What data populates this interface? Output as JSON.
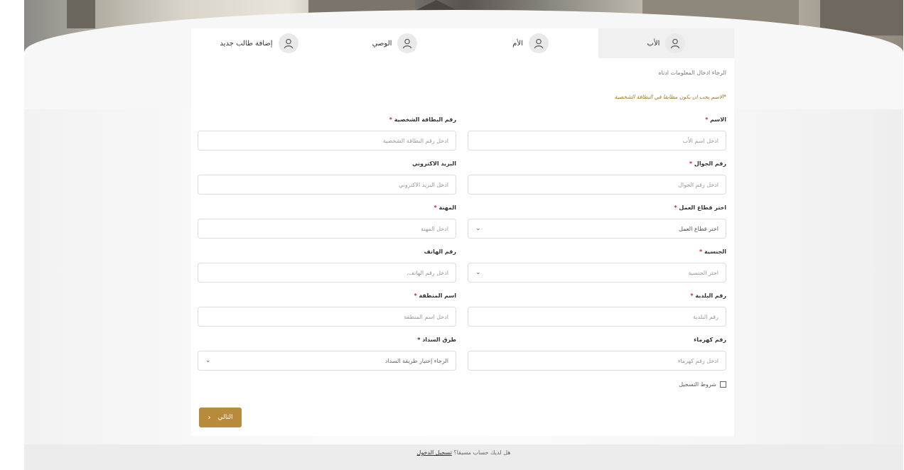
{
  "tabs": [
    {
      "label": "الأب",
      "icon": "user-icon",
      "active": true
    },
    {
      "label": "الأم",
      "icon": "user-icon",
      "active": false
    },
    {
      "label": "الوصي",
      "icon": "user-icon",
      "active": false
    },
    {
      "label": "إضافة طالب جديد",
      "icon": "user-icon",
      "active": false
    }
  ],
  "notes": {
    "intro": "الرجاء ادخال المعلومات ادناه",
    "name_warning": "*الاسم يجب ان يكون مطابقا في البطاقة الشخصية"
  },
  "fields": {
    "name": {
      "label": "الاسم",
      "required": "*",
      "placeholder": "ادخل اسم الأب"
    },
    "id_number": {
      "label": "رقم البطاقة الشخصية",
      "required": "*",
      "placeholder": "ادخل رقم البطاقة الشخصية"
    },
    "mobile": {
      "label": "رقم الجوال",
      "required": "*",
      "placeholder": "ادخل رقم الجوال"
    },
    "email": {
      "label": "البريد الاكتروني",
      "required": "",
      "placeholder": "ادخل البريد الاكتروني"
    },
    "work_sector": {
      "label": "اختر قطاع العمل",
      "required": "*",
      "placeholder": "اختر قطاع العمل"
    },
    "profession": {
      "label": "المهنة",
      "required": "*",
      "placeholder": "ادخل المهنة"
    },
    "nationality": {
      "label": "الجنسية",
      "required": "*",
      "placeholder": "اختر الجنسية"
    },
    "phone": {
      "label": "رقم الهاتف",
      "required": "",
      "placeholder": "ادخل رقم الهاتف."
    },
    "municipality": {
      "label": "رقم البلدية",
      "required": "*",
      "placeholder": "رقم البلدية"
    },
    "area_name": {
      "label": "اسم المنطقة",
      "required": "*",
      "placeholder": "ادخل اسم المنطقة"
    },
    "kahramaa": {
      "label": "رقم كهرماء",
      "required": "",
      "placeholder": "ادخل رقم كهرماء"
    },
    "payment": {
      "label": "طرق السداد",
      "required": "*",
      "placeholder": "الرجاء إختيار طريقة السداد"
    }
  },
  "terms_label": "شروط التسجيل",
  "next_button": "التالي",
  "login_prompt": "هل لديك حساب مسبقا؟",
  "login_link": "تسجيل الدخول"
}
